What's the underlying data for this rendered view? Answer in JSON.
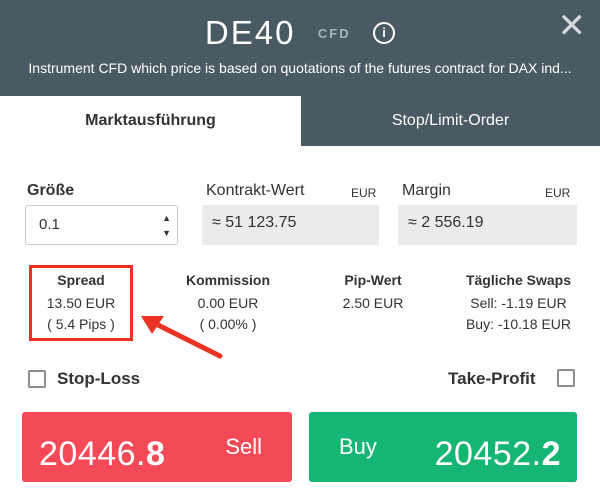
{
  "header": {
    "symbol": "DE40",
    "type_badge": "CFD",
    "info_glyph": "i",
    "close_glyph": "✕",
    "subtitle": "Instrument CFD which price is based on quotations of the futures contract for DAX ind..."
  },
  "tabs": [
    {
      "label": "Marktausführung",
      "active": true
    },
    {
      "label": "Stop/Limit-Order",
      "active": false
    }
  ],
  "fields": {
    "size": {
      "label": "Größe",
      "value": "0.1",
      "stepper_up": "▲",
      "stepper_down": "▼"
    },
    "contract_value": {
      "label": "Kontrakt-Wert",
      "currency": "EUR",
      "value": "≈ 51 123.75"
    },
    "margin": {
      "label": "Margin",
      "currency": "EUR",
      "value": "≈ 2 556.19"
    }
  },
  "stats": {
    "spread": {
      "label": "Spread",
      "line1": "13.50 EUR",
      "line2": "( 5.4 Pips )"
    },
    "commission": {
      "label": "Kommission",
      "line1": "0.00 EUR",
      "line2": "( 0.00% )"
    },
    "pip_value": {
      "label": "Pip-Wert",
      "line1": "2.50 EUR"
    },
    "swaps": {
      "label": "Tägliche Swaps",
      "line1": "Sell: -1.19 EUR",
      "line2": "Buy: -10.18 EUR"
    }
  },
  "options": {
    "stop_loss": {
      "label": "Stop-Loss",
      "checked": false
    },
    "take_profit": {
      "label": "Take-Profit",
      "checked": false
    }
  },
  "trade": {
    "sell": {
      "label": "Sell",
      "price_main": "20446.",
      "price_big": "8"
    },
    "buy": {
      "label": "Buy",
      "price_main": "20452.",
      "price_big": "2"
    }
  },
  "colors": {
    "header_bg": "#4a5a62",
    "sell": "#f44a58",
    "buy": "#15b573",
    "highlight": "#ea3323"
  },
  "icons": {
    "info": "info-icon",
    "close": "close-icon",
    "annotation_arrow": "arrow-icon"
  }
}
